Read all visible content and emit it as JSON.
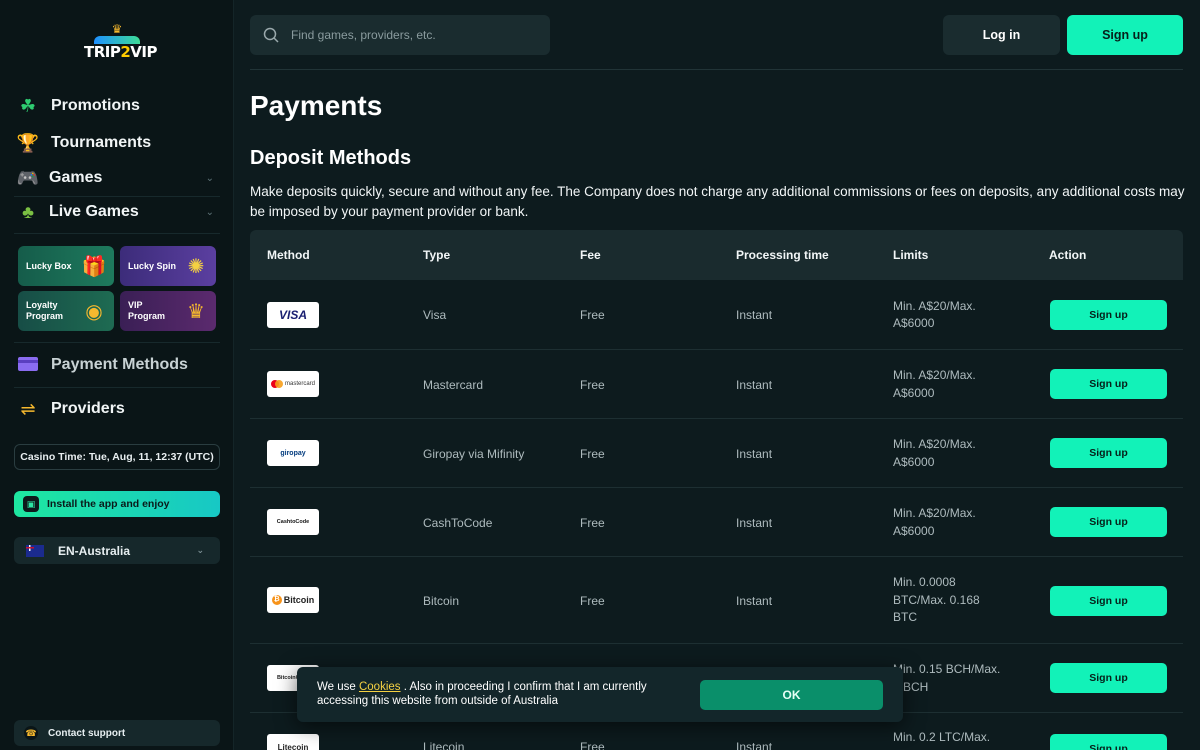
{
  "brand": {
    "logo_text_left": "TRIP",
    "logo_text_mid": "2",
    "logo_text_right": "VIP"
  },
  "sidebar": {
    "nav": [
      {
        "label": "Promotions",
        "icon": "clover-icon"
      },
      {
        "label": "Tournaments",
        "icon": "trophy-icon"
      },
      {
        "label": "Games",
        "icon": "gamepad-icon"
      },
      {
        "label": "Live Games",
        "icon": "chips-icon"
      }
    ],
    "promos": [
      {
        "label": "Lucky Box"
      },
      {
        "label": "Lucky Spin"
      },
      {
        "label": "Loyalty Program"
      },
      {
        "label": "VIP Program"
      }
    ],
    "payment_methods": "Payment Methods",
    "providers": "Providers",
    "casino_time": "Casino Time: Tue, Aug, 11, 12:37 (UTC)",
    "install": "Install the app and enjoy",
    "language": "EN-Australia",
    "support": "Contact support"
  },
  "header": {
    "search_placeholder": "Find games, providers, etc.",
    "login": "Log in",
    "signup": "Sign up"
  },
  "page": {
    "title": "Payments",
    "section": "Deposit Methods",
    "description": "Make deposits quickly, secure and without any fee. The Company does not charge any additional commissions or fees on deposits, any additional costs may be imposed by your payment provider or bank."
  },
  "table": {
    "columns": [
      "Method",
      "Type",
      "Fee",
      "Processing time",
      "Limits",
      "Action"
    ],
    "rows": [
      {
        "logo": "VISA",
        "type": "Visa",
        "fee": "Free",
        "time": "Instant",
        "limits": [
          "Min. A$20/Max.",
          "A$6000"
        ],
        "action": "Sign up"
      },
      {
        "logo": "mastercard",
        "type": "Mastercard",
        "fee": "Free",
        "time": "Instant",
        "limits": [
          "Min. A$20/Max.",
          "A$6000"
        ],
        "action": "Sign up"
      },
      {
        "logo": "giropay",
        "type": "Giropay via Mifinity",
        "fee": "Free",
        "time": "Instant",
        "limits": [
          "Min. A$20/Max.",
          "A$6000"
        ],
        "action": "Sign up"
      },
      {
        "logo": "CashtoCode",
        "type": "CashToCode",
        "fee": "Free",
        "time": "Instant",
        "limits": [
          "Min. A$20/Max.",
          "A$6000"
        ],
        "action": "Sign up"
      },
      {
        "logo": "Bitcoin",
        "type": "Bitcoin",
        "fee": "Free",
        "time": "Instant",
        "limits": [
          "Min. 0.0008",
          "BTC/Max. 0.168",
          "BTC"
        ],
        "action": "Sign up"
      },
      {
        "logo": "BitcoinCash",
        "type": "",
        "fee": "",
        "time": "",
        "limits": [
          "Min. 0.15 BCH/Max.",
          "0 BCH"
        ],
        "action": "Sign up"
      },
      {
        "logo": "Litecoin",
        "type": "Litecoin",
        "fee": "Free",
        "time": "Instant",
        "limits": [
          "Min. 0.2 LTC/Max."
        ],
        "action": "Sign up"
      }
    ]
  },
  "cookie": {
    "text_before": "We use ",
    "link": "Cookies",
    "text_after": " . Also in proceeding I confirm that I am currently accessing this website from outside of Australia",
    "ok": "OK"
  },
  "colors": {
    "accent": "#12f2b8",
    "bg": "#0d1b1e",
    "sidebar": "#0a1517",
    "panel": "#1a2c2f"
  }
}
